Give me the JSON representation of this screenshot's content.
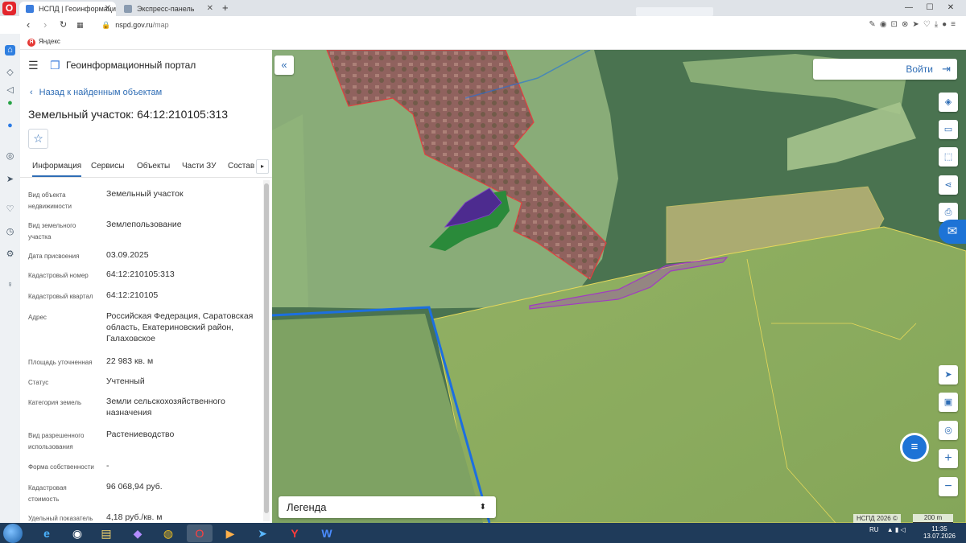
{
  "browser": {
    "tabs": [
      {
        "title": "НСПД | Геоинформацион",
        "active": true
      },
      {
        "title": "Экспресс-панель",
        "active": false
      }
    ],
    "new_tab": "+",
    "url_host": "nspd.gov.ru",
    "url_path": "/map",
    "bookmark": "Яндекс",
    "window_controls": [
      "—",
      "☐",
      "✕"
    ]
  },
  "app": {
    "portal_title": "Геоинформационный портал",
    "back_link": "Назад к найденным объектам",
    "object_title": "Земельный участок: 64:12:210105:313",
    "tabs": [
      "Информация",
      "Сервисы",
      "Объекты",
      "Части ЗУ",
      "Состав"
    ],
    "active_tab": "Информация",
    "attributes": [
      {
        "label": "Вид объекта недвижимости",
        "value": "Земельный участок"
      },
      {
        "label": "Вид земельного участка",
        "value": "Землепользование"
      },
      {
        "label": "Дата присвоения",
        "value": "03.09.2025"
      },
      {
        "label": "Кадастровый номер",
        "value": "64:12:210105:313"
      },
      {
        "label": "Кадастровый квартал",
        "value": "64:12:210105"
      },
      {
        "label": "Адрес",
        "value": "Российская Федерация, Саратовская область, Екатериновский район, Галаховское"
      },
      {
        "label": "Площадь уточненная",
        "value": "22 983 кв. м"
      },
      {
        "label": "Статус",
        "value": "Учтенный"
      },
      {
        "label": "Категория земель",
        "value": "Земли сельскохозяйственного назначения"
      },
      {
        "label": "Вид разрешенного использования",
        "value": "Растениеводство"
      },
      {
        "label": "Форма собственности",
        "value": "-"
      },
      {
        "label": "Кадастровая стоимость",
        "value": "96 068,94 руб."
      },
      {
        "label": "Удельный показатель",
        "value": "4,18 руб./кв. м"
      }
    ]
  },
  "map": {
    "login_label": "Войти",
    "legend_label": "Легенда",
    "attribution": "НСПД 2026 ©",
    "scale_label": "200 m",
    "colors": {
      "accent": "#2f6db5",
      "parcel_red": "#e0413f",
      "parcel_purple": "#a13bc2",
      "zone_yellow": "#e6d95a",
      "boundary_blue": "#1c6fe0"
    }
  },
  "taskbar": {
    "lang": "RU",
    "time": "11:35",
    "date": "13.07.2026"
  }
}
